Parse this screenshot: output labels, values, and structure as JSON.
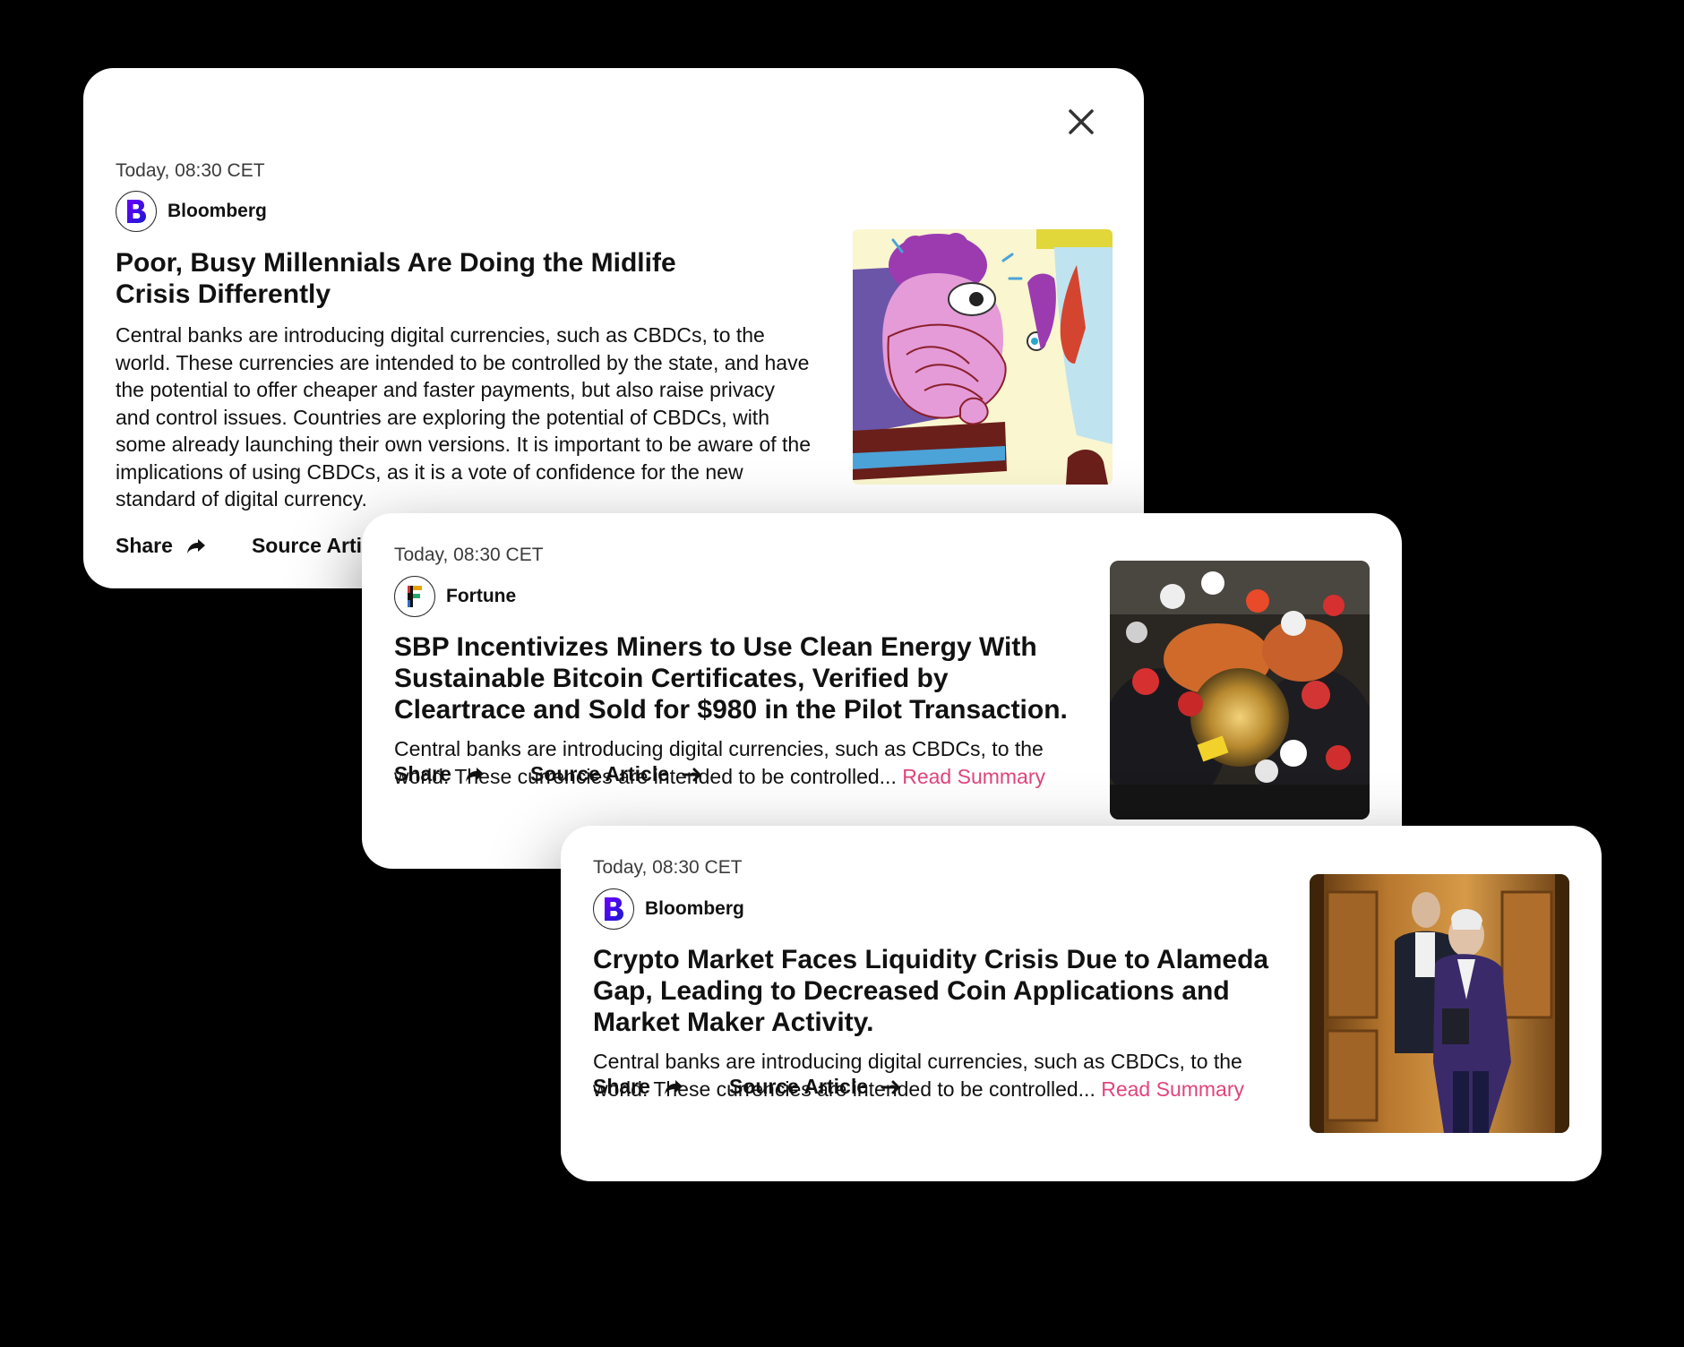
{
  "cards": [
    {
      "timestamp": "Today, 08:30 CET",
      "source": "Bloomberg",
      "logo_letter": "B",
      "headline": "Poor, Busy Millennials Are Doing the Midlife Crisis Differently",
      "body": "Central banks are introducing digital currencies, such as CBDCs, to the world. These currencies are intended to be controlled by the state, and have the potential to offer cheaper and faster payments, but also raise privacy and control issues. Countries are exploring the potential of CBDCs, with some already launching their own versions. It is important to be aware of the implications of using CBDCs, as it is a vote of confidence for the new standard of digital currency.",
      "share_label": "Share",
      "source_article_label": "Source Article",
      "image": "illustration"
    },
    {
      "timestamp": "Today, 08:30 CET",
      "source": "Fortune",
      "logo_letter": "F",
      "headline": "SBP Incentivizes Miners to Use Clean Energy With Sustainable Bitcoin Certificates, Verified by Cleartrace and Sold for $980 in the Pilot Transaction.",
      "body": "Central banks are introducing digital currencies, such as CBDCs, to the world. These currencies are intended to be controlled...",
      "read_summary": "Read Summary",
      "share_label": "Share",
      "source_article_label": "Source Article",
      "image": "rescue-workers-photo"
    },
    {
      "timestamp": "Today, 08:30 CET",
      "source": "Bloomberg",
      "logo_letter": "B",
      "headline": "Crypto Market Faces Liquidity Crisis Due to Alameda Gap, Leading to Decreased Coin Applications and Market Maker Activity.",
      "body": "Central banks are introducing digital currencies, such as CBDCs, to the world. These currencies are intended to be controlled...",
      "read_summary": "Read Summary",
      "share_label": "Share",
      "source_article_label": "Source Article",
      "image": "elevator-photo"
    }
  ],
  "colors": {
    "background": "#000000",
    "card": "#ffffff",
    "link": "#e0457b",
    "bloomberg_logo": "#3a10e5"
  },
  "icons": [
    "close-icon",
    "share-icon",
    "arrow-right-icon"
  ]
}
